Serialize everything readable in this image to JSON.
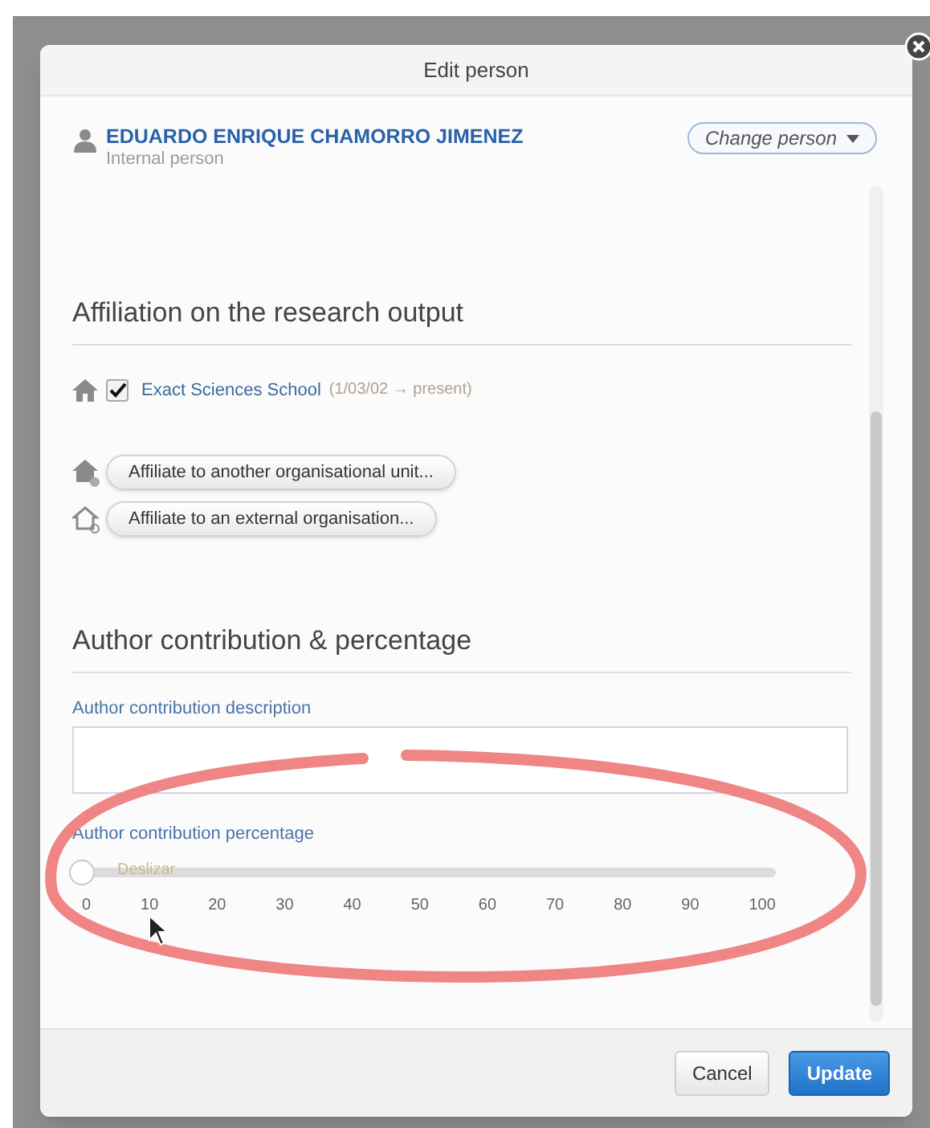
{
  "dialog": {
    "title": "Edit person"
  },
  "person": {
    "name": "EDUARDO ENRIQUE CHAMORRO JIMENEZ",
    "type": "Internal person",
    "change_button": "Change person"
  },
  "affiliation": {
    "heading": "Affiliation on the research output",
    "items": [
      {
        "name": "Exact Sciences School",
        "period": "(1/03/02 → present)",
        "checked": true
      }
    ],
    "buttons": [
      {
        "label": "Affiliate to another organisational unit...",
        "kind": "internal"
      },
      {
        "label": "Affiliate to an external organisation...",
        "kind": "external"
      }
    ]
  },
  "contribution": {
    "heading": "Author contribution & percentage",
    "description_label": "Author contribution description",
    "percentage_label": "Author contribution percentage",
    "slider": {
      "level": 0,
      "hint": "Deslizar",
      "ticks": [
        "0",
        "10",
        "20",
        "30",
        "40",
        "50",
        "60",
        "70",
        "80",
        "90",
        "100"
      ]
    }
  },
  "buttons": [
    {
      "label": "Cancel",
      "kind": "secondary"
    },
    {
      "label": "Update",
      "kind": "primary"
    }
  ]
}
